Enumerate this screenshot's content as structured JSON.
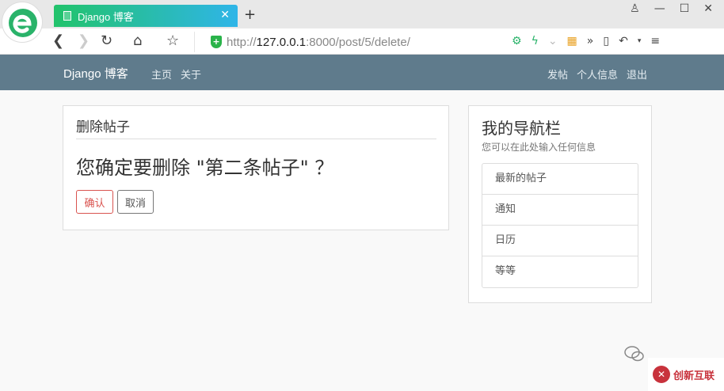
{
  "browser": {
    "tab_title": "Django 博客",
    "tab_close": "✕",
    "new_tab": "+",
    "url_prefix": "http://",
    "url_host": "127.0.0.1",
    "url_rest": ":8000/post/5/delete/",
    "icons": [
      "back-icon",
      "forward-icon",
      "reload-icon",
      "home-icon",
      "star-icon",
      "shield-icon"
    ]
  },
  "site": {
    "brand": "Django 博客",
    "nav_left": [
      "主页",
      "关于"
    ],
    "nav_right": [
      "发帖",
      "个人信息",
      "退出"
    ]
  },
  "main": {
    "heading": "删除帖子",
    "question": "您确定要删除 \"第二条帖子\" ？",
    "confirm_label": "确认",
    "cancel_label": "取消"
  },
  "sidebar": {
    "title": "我的导航栏",
    "subtitle": "您可以在此处输入任何信息",
    "items": [
      "最新的帖子",
      "通知",
      "日历",
      "等等"
    ]
  },
  "colors": {
    "navbar": "#5f7b8c",
    "danger": "#d9534f",
    "tab_start": "#22c36b",
    "tab_end": "#2fb5e8"
  }
}
